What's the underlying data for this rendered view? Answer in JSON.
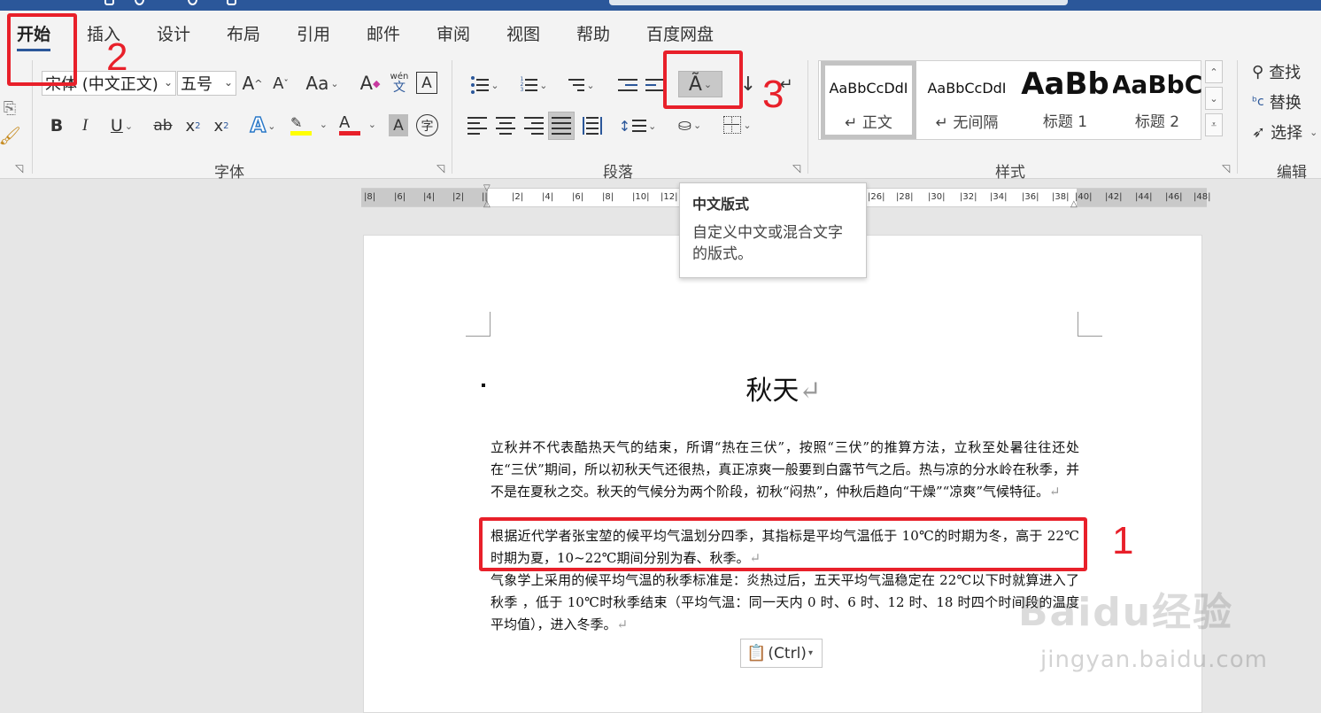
{
  "tabs": [
    {
      "label": "开始",
      "active": true
    },
    {
      "label": "插入"
    },
    {
      "label": "设计"
    },
    {
      "label": "布局"
    },
    {
      "label": "引用"
    },
    {
      "label": "邮件"
    },
    {
      "label": "审阅"
    },
    {
      "label": "视图"
    },
    {
      "label": "帮助"
    },
    {
      "label": "百度网盘"
    }
  ],
  "font": {
    "name": "宋体 (中文正文)",
    "size": "五号",
    "grow": "A",
    "shrink": "A",
    "case": "Aa",
    "pinyin_top": "wén",
    "pinyin_bottom": "文",
    "border_char": "A",
    "bold": "B",
    "italic": "I",
    "underline": "U",
    "strike": "ab",
    "sub": "x",
    "sub_mark": "2",
    "sup": "x",
    "sup_mark": "2",
    "effects": "A",
    "color": "A",
    "shade_char": "A",
    "enclose_char": "字",
    "group_label": "字体"
  },
  "paragraph": {
    "group_label": "段落"
  },
  "styles": {
    "group_label": "样式",
    "items": [
      {
        "preview": "AaBbCcDdI",
        "name": "↵ 正文"
      },
      {
        "preview": "AaBbCcDdI",
        "name": "↵ 无间隔"
      },
      {
        "preview": "AaBb",
        "name": "标题 1"
      },
      {
        "preview": "AaBbC",
        "name": "标题 2"
      }
    ]
  },
  "editing": {
    "find": "查找",
    "replace": "替换",
    "select": "选择",
    "group_label": "编辑"
  },
  "ruler": {
    "labels": [
      "8",
      "6",
      "4",
      "2",
      "",
      "2",
      "4",
      "6",
      "8",
      "10",
      "12",
      "26",
      "28",
      "30",
      "32",
      "34",
      "36",
      "38",
      "40",
      "42",
      "44",
      "46",
      "48"
    ]
  },
  "tooltip": {
    "title": "中文版式",
    "desc": "自定义中文或混合文字的版式。"
  },
  "document": {
    "title": "秋天",
    "para1": "立秋并不代表酷热天气的结束，所谓“热在三伏”，按照“三伏”的推算方法，立秋至处暑往往还处在“三伏”期间，所以初秋天气还很热，真正凉爽一般要到白露节气之后。热与凉的分水岭在秋季，并不是在夏秋之交。秋天的气候分为两个阶段，初秋“闷热”，仲秋后趋向“干燥”“凉爽”气候特征。",
    "para2": "根据近代学者张宝堃的候平均气温划分四季，其指标是平均气温低于 10℃的时期为冬，高于 22℃时期为夏，10~22℃期间分别为春、秋季。",
    "para3": "气象学上采用的候平均气温的秋季标准是：炎热过后，五天平均气温稳定在 22℃以下时就算进入了秋季 ，低于 10℃时秋季结束（平均气温：同一天内 0 时、6 时、12 时、18 时四个时间段的温度平均值），进入冬季。",
    "pilcrow": "↵"
  },
  "paste_options": "(Ctrl)",
  "annotations": [
    "1",
    "2",
    "3"
  ],
  "watermark": {
    "text": "Baidu经验",
    "sub": "jingyan.baidu.com"
  },
  "colors": {
    "accent": "#2b579a",
    "annotation": "#e8202a",
    "highlight": "#ffff00",
    "font_color": "#e8202a"
  }
}
